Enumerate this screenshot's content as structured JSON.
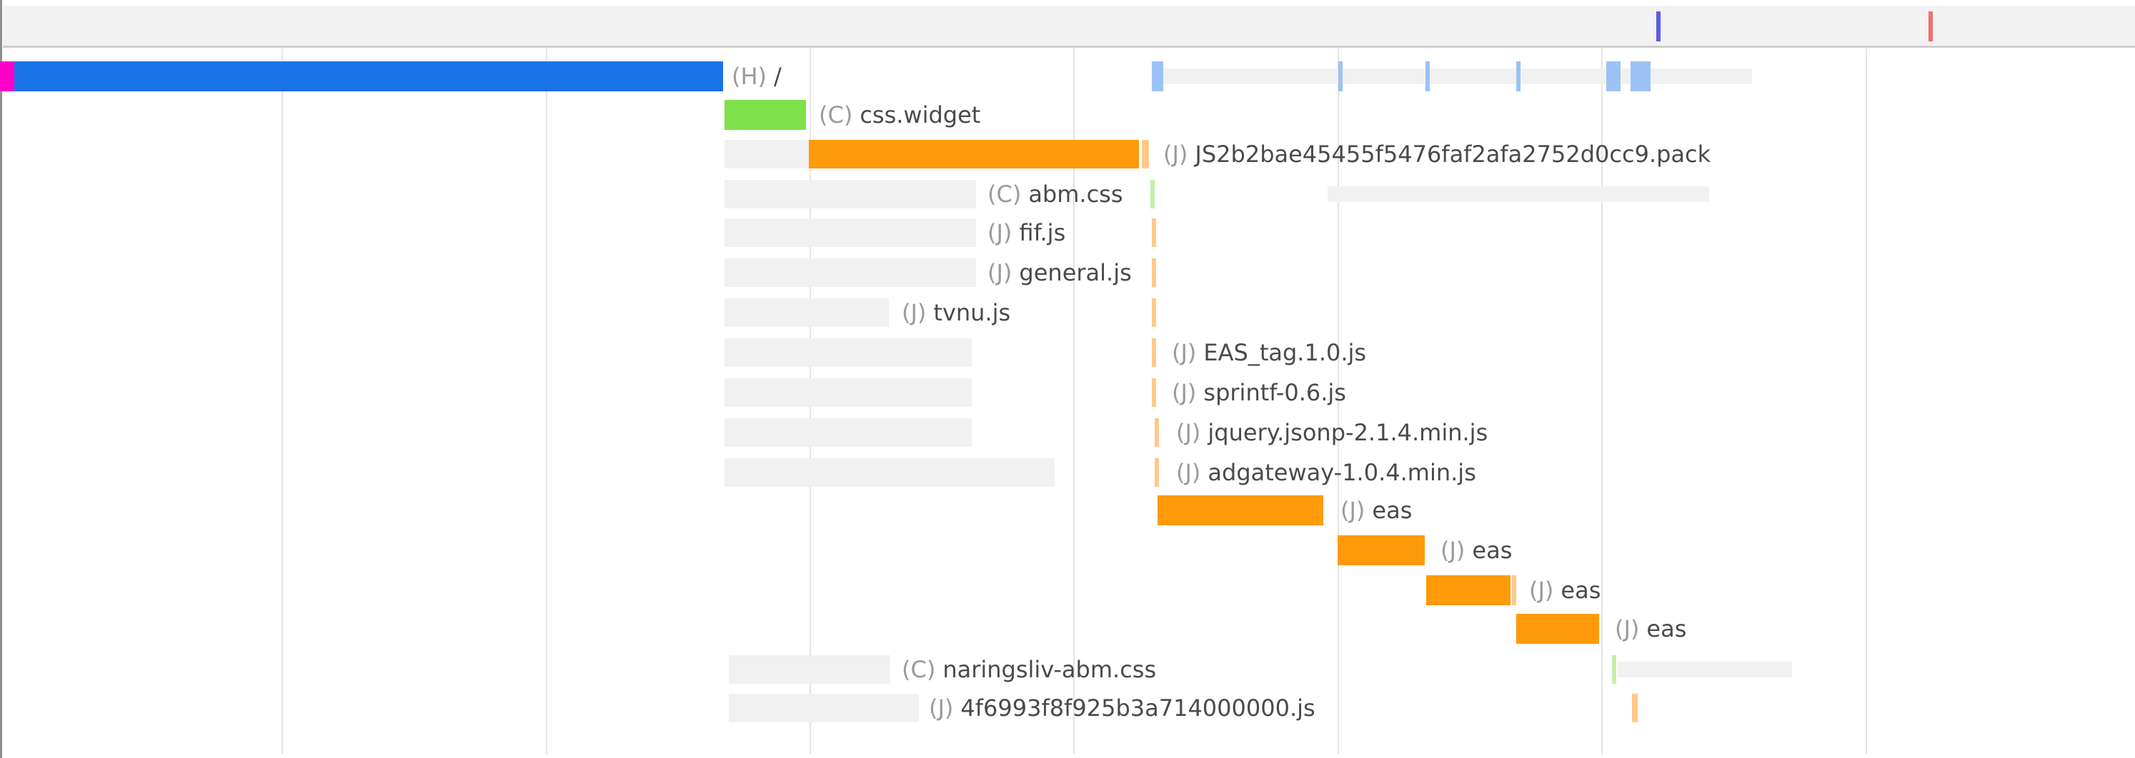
{
  "colors": {
    "html": "#1a73e8",
    "css": "#7ee04a",
    "js": "#ff9a0a",
    "js_light": "#ffc98a",
    "css_light": "#c2f0a8",
    "html_light": "#9cc2f5",
    "idle": "#f1f1f1",
    "marker_start": "#ff00c8",
    "marker_dom": "#5b5be8",
    "marker_load": "#f07070",
    "grid": "#e4e4e4"
  },
  "header": {
    "markers": [
      {
        "name": "dom-content-loaded-marker",
        "color": "#5b5be8"
      },
      {
        "name": "load-marker",
        "color": "#f07070"
      }
    ]
  },
  "requests": [
    {
      "type": "(H)",
      "name": "/"
    },
    {
      "type": "(C)",
      "name": "css.widget"
    },
    {
      "type": "(J)",
      "name": "JS2b2bae45455f5476faf2afa2752d0cc9.pack"
    },
    {
      "type": "(C)",
      "name": "abm.css"
    },
    {
      "type": "(J)",
      "name": "fif.js"
    },
    {
      "type": "(J)",
      "name": "general.js"
    },
    {
      "type": "(J)",
      "name": "tvnu.js"
    },
    {
      "type": "(J)",
      "name": "EAS_tag.1.0.js"
    },
    {
      "type": "(J)",
      "name": "sprintf-0.6.js"
    },
    {
      "type": "(J)",
      "name": "jquery.jsonp-2.1.4.min.js"
    },
    {
      "type": "(J)",
      "name": "adgateway-1.0.4.min.js"
    },
    {
      "type": "(J)",
      "name": "eas"
    },
    {
      "type": "(J)",
      "name": "eas"
    },
    {
      "type": "(J)",
      "name": "eas"
    },
    {
      "type": "(J)",
      "name": "eas"
    },
    {
      "type": "(C)",
      "name": "naringsliv-abm.css"
    },
    {
      "type": "(J)",
      "name": "4f6993f8f925b3a714000000.js"
    }
  ]
}
